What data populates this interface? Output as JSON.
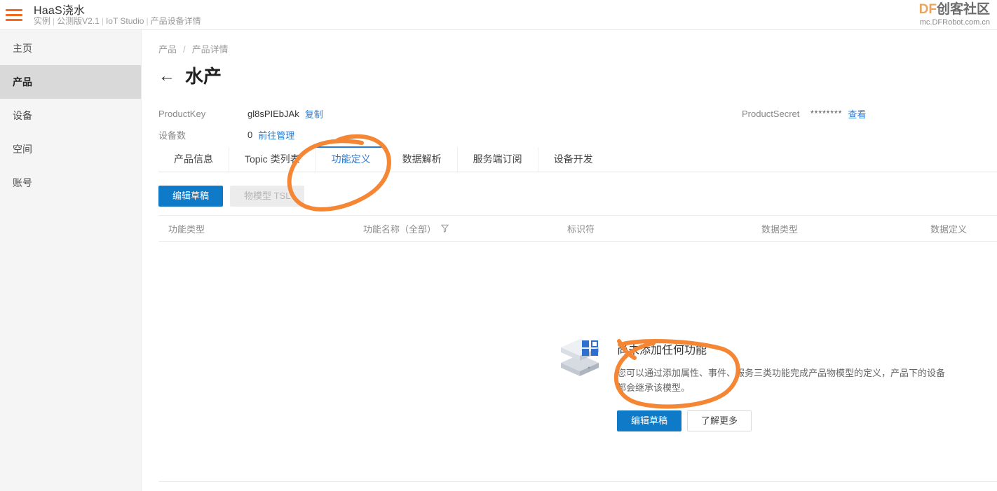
{
  "header": {
    "menu_icon": "hamburger-icon",
    "title": "HaaS浇水",
    "subtitle_parts": [
      "实例",
      "公测版V2.1",
      "IoT Studio",
      "产品设备详情"
    ],
    "watermark_df": "DF",
    "watermark_cn": "创客社区",
    "watermark_url": "mc.DFRobot.com.cn",
    "watermark_color": "#e8a35e",
    "accent_color": "#f26a21"
  },
  "sidebar": {
    "items": [
      {
        "label": "主页",
        "active": false
      },
      {
        "label": "产品",
        "active": true
      },
      {
        "label": "设备",
        "active": false
      },
      {
        "label": "空间",
        "active": false
      },
      {
        "label": "账号",
        "active": false
      }
    ],
    "active_background": "#d9d9d9"
  },
  "breadcrumb": {
    "parent": "产品",
    "separator": "/",
    "current": "产品详情"
  },
  "page": {
    "back_icon": "arrow-left-icon",
    "title": "水产"
  },
  "product_meta": {
    "product_key_label": "ProductKey",
    "product_key_value": "gl8sPIEbJAk",
    "product_key_copy": "复制",
    "device_count_label": "设备数",
    "device_count_value": "0",
    "device_manage_link": "前往管理",
    "product_secret_label": "ProductSecret",
    "product_secret_value": "********",
    "product_secret_view": "查看",
    "link_color": "#2a7bd4"
  },
  "tabs": [
    {
      "label": "产品信息",
      "active": false
    },
    {
      "label": "Topic 类列表",
      "active": false
    },
    {
      "label": "功能定义",
      "active": true
    },
    {
      "label": "数据解析",
      "active": false
    },
    {
      "label": "服务端订阅",
      "active": false
    },
    {
      "label": "设备开发",
      "active": false
    }
  ],
  "toolbar": {
    "edit_draft_label": "编辑草稿",
    "tsl_label": "物模型 TSL",
    "tsl_disabled": true,
    "primary_color": "#0f7ac7"
  },
  "table": {
    "columns": [
      "功能类型",
      "功能名称（全部）",
      "标识符",
      "数据类型",
      "数据定义"
    ],
    "filter_icon": "filter-icon",
    "rows": []
  },
  "empty_state": {
    "icon": "package-box-icon",
    "title": "尚未添加任何功能",
    "description": "您可以通过添加属性、事件、服务三类功能完成产品物模型的定义，产品下的设备都会继承该模型。",
    "primary_button": "编辑草稿",
    "secondary_button": "了解更多"
  },
  "annotations": {
    "color": "#f58634",
    "marks": [
      {
        "name": "circle-around-feature-tab"
      },
      {
        "name": "circle-around-empty-state-buttons"
      }
    ]
  }
}
